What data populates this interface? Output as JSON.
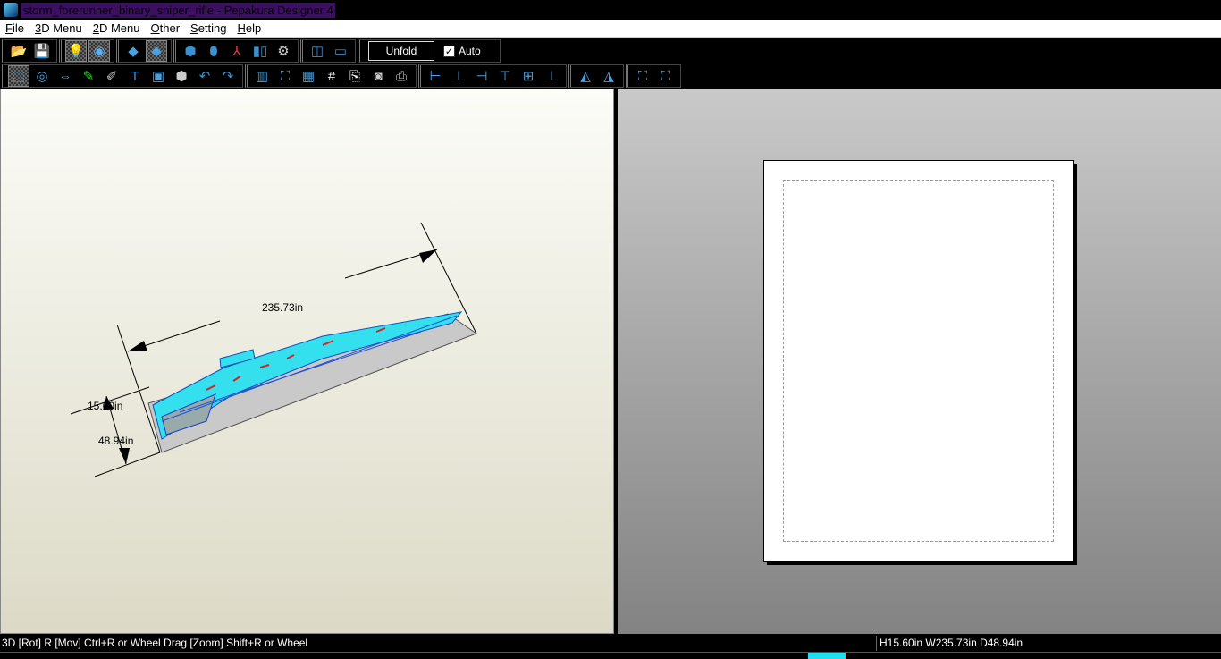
{
  "window": {
    "title": "storm_forerunner_binary_sniper_rifle - Pepakura Designer 4"
  },
  "menu": [
    {
      "key": "F",
      "rest": "ile"
    },
    {
      "key": "3",
      "rest": "D Menu"
    },
    {
      "key": "2",
      "rest": "D Menu"
    },
    {
      "key": "O",
      "rest": "ther"
    },
    {
      "key": "S",
      "rest": "etting"
    },
    {
      "key": "H",
      "rest": "elp"
    }
  ],
  "toolbar1": {
    "groups": [
      [
        {
          "name": "open-folder-icon",
          "g": "📂",
          "c": "#3a8fd8"
        },
        {
          "name": "save-icon",
          "g": "💾",
          "c": "#4a8fd8"
        }
      ],
      [
        {
          "name": "light-bulb-icon",
          "g": "💡",
          "c": "#ff0",
          "on": true
        },
        {
          "name": "texture-icon",
          "g": "◉",
          "c": "#5ab0f0",
          "on": true
        }
      ],
      [
        {
          "name": "select-face-icon",
          "g": "◆",
          "c": "#4aa0e0"
        },
        {
          "name": "select-part-icon",
          "g": "◆",
          "c": "#4aa0e0",
          "on": true
        }
      ],
      [
        {
          "name": "edge-icon",
          "g": "⬢",
          "c": "#3a90d0"
        },
        {
          "name": "cylinder-icon",
          "g": "⬮",
          "c": "#3a90d0"
        },
        {
          "name": "axes-icon",
          "g": "⅄",
          "c": "#e33"
        },
        {
          "name": "mirror-icon",
          "g": "▮▯",
          "c": "#3a90d0"
        },
        {
          "name": "settings-icon",
          "g": "⚙",
          "c": "#ccc"
        }
      ],
      [
        {
          "name": "split-view-icon",
          "g": "◫",
          "c": "#3a90d0"
        },
        {
          "name": "single-view-icon",
          "g": "▭",
          "c": "#3a90d0"
        }
      ]
    ],
    "unfold_label": "Unfold",
    "auto_label": "Auto",
    "auto_checked": "✓"
  },
  "toolbar2": {
    "groups": [
      [
        {
          "name": "rotate-select-icon",
          "g": "⬚",
          "c": "#4aa0e0",
          "on": true
        },
        {
          "name": "rotate-part-icon",
          "g": "◎",
          "c": "#4aa0e0"
        },
        {
          "name": "move-part-icon",
          "g": "⇔",
          "c": "#4aa0e0"
        },
        {
          "name": "draw-line-icon",
          "g": "✎",
          "c": "#3c3"
        },
        {
          "name": "eraser-icon",
          "g": "✐",
          "c": "#ccc"
        },
        {
          "name": "text-icon",
          "g": "T",
          "c": "#3a90d0"
        },
        {
          "name": "image-icon",
          "g": "▣",
          "c": "#4aa0e0"
        },
        {
          "name": "box-3d-icon",
          "g": "⬢",
          "c": "#ccc"
        },
        {
          "name": "undo-icon",
          "g": "↶",
          "c": "#3a90d0"
        },
        {
          "name": "redo-icon",
          "g": "↷",
          "c": "#3a90d0"
        }
      ],
      [
        {
          "name": "unfold-map-icon",
          "g": "▥",
          "c": "#4aa0e0"
        },
        {
          "name": "fit-page-icon",
          "g": "⛶",
          "c": "#4aa0e0"
        },
        {
          "name": "grid-layout-icon",
          "g": "▦",
          "c": "#4aa0e0"
        },
        {
          "name": "page-number-icon",
          "g": "#",
          "c": "#fff"
        },
        {
          "name": "export-icon",
          "g": "⎘",
          "c": "#fff"
        },
        {
          "name": "print-preview-icon",
          "g": "◙",
          "c": "#ccc"
        },
        {
          "name": "print-icon",
          "g": "⎙",
          "c": "#ccc"
        }
      ],
      [
        {
          "name": "align-left-icon",
          "g": "⊢",
          "c": "#4aa0e0"
        },
        {
          "name": "align-center-icon",
          "g": "⊥",
          "c": "#4aa0e0"
        },
        {
          "name": "align-right-icon",
          "g": "⊣",
          "c": "#4aa0e0"
        },
        {
          "name": "align-top-icon",
          "g": "⊤",
          "c": "#4aa0e0"
        },
        {
          "name": "align-middle-icon",
          "g": "⊞",
          "c": "#4aa0e0"
        },
        {
          "name": "align-bottom-icon",
          "g": "⊥",
          "c": "#4aa0e0"
        }
      ],
      [
        {
          "name": "flip-horizontal-icon",
          "g": "◭",
          "c": "#4aa0e0"
        },
        {
          "name": "flip-vertical-icon",
          "g": "◮",
          "c": "#4aa0e0"
        }
      ],
      [
        {
          "name": "zoom-fit-icon",
          "g": "⛶",
          "c": "#4aa0e0"
        },
        {
          "name": "zoom-all-icon",
          "g": "⛶",
          "c": "#4aa0e0"
        }
      ]
    ]
  },
  "view3d": {
    "dim_width": "235.73in",
    "dim_height": "15.60in",
    "dim_depth": "48.94in"
  },
  "status": {
    "hint": "3D [Rot] R [Mov] Ctrl+R or Wheel Drag [Zoom] Shift+R or Wheel",
    "size": "H15.60in W235.73in D48.94in"
  }
}
